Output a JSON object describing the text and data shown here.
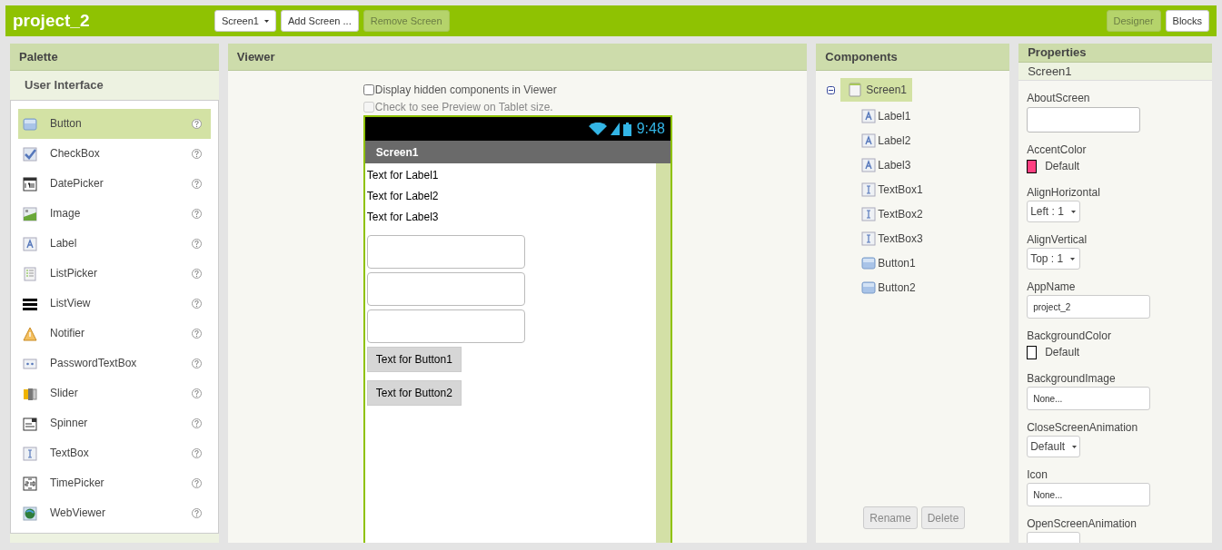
{
  "project_title": "project_2",
  "toolbar": {
    "screen_selector": "Screen1",
    "buttons": [
      {
        "label": "Add Screen ...",
        "disabled": false
      },
      {
        "label": "Remove Screen",
        "disabled": true
      }
    ]
  },
  "view_switch": [
    {
      "label": "Designer",
      "selected": true
    },
    {
      "label": "Blocks",
      "selected": false
    }
  ],
  "palette": {
    "title": "Palette",
    "category": "User Interface",
    "items": [
      {
        "label": "Button",
        "kind": "button",
        "selected": true
      },
      {
        "label": "CheckBox",
        "kind": "checkbox",
        "selected": false
      },
      {
        "label": "DatePicker",
        "kind": "datepicker",
        "selected": false
      },
      {
        "label": "Image",
        "kind": "image",
        "selected": false
      },
      {
        "label": "Label",
        "kind": "label",
        "selected": false
      },
      {
        "label": "ListPicker",
        "kind": "listpicker",
        "selected": false
      },
      {
        "label": "ListView",
        "kind": "listview",
        "selected": false
      },
      {
        "label": "Notifier",
        "kind": "notifier",
        "selected": false
      },
      {
        "label": "PasswordTextBox",
        "kind": "password",
        "selected": false
      },
      {
        "label": "Slider",
        "kind": "slider",
        "selected": false
      },
      {
        "label": "Spinner",
        "kind": "spinner",
        "selected": false
      },
      {
        "label": "TextBox",
        "kind": "textbox",
        "selected": false
      },
      {
        "label": "TimePicker",
        "kind": "timepicker",
        "selected": false
      },
      {
        "label": "WebViewer",
        "kind": "webviewer",
        "selected": false
      }
    ]
  },
  "viewer": {
    "title": "Viewer",
    "options": [
      {
        "label": "Display hidden components in Viewer",
        "checked": false,
        "disabled": false
      },
      {
        "label": "Check to see Preview on Tablet size.",
        "checked": false,
        "disabled": true
      }
    ],
    "phone": {
      "time": "9:48",
      "screen_title": "Screen1",
      "components": [
        {
          "kind": "label",
          "text": "Text for Label1"
        },
        {
          "kind": "label",
          "text": "Text for Label2"
        },
        {
          "kind": "label",
          "text": "Text for Label3"
        },
        {
          "kind": "textbox"
        },
        {
          "kind": "textbox"
        },
        {
          "kind": "textbox"
        },
        {
          "kind": "button",
          "text": "Text for Button1"
        },
        {
          "kind": "button",
          "text": "Text for Button2"
        }
      ]
    }
  },
  "components": {
    "title": "Components",
    "tree": {
      "label": "Screen1",
      "kind": "screen",
      "expanded": true,
      "selected": true,
      "children": [
        {
          "label": "Label1",
          "kind": "label"
        },
        {
          "label": "Label2",
          "kind": "label"
        },
        {
          "label": "Label3",
          "kind": "label"
        },
        {
          "label": "TextBox1",
          "kind": "textbox"
        },
        {
          "label": "TextBox2",
          "kind": "textbox"
        },
        {
          "label": "TextBox3",
          "kind": "textbox"
        },
        {
          "label": "Button1",
          "kind": "button"
        },
        {
          "label": "Button2",
          "kind": "button"
        }
      ]
    },
    "buttons": [
      {
        "label": "Rename",
        "disabled": true
      },
      {
        "label": "Delete",
        "disabled": true
      }
    ]
  },
  "properties": {
    "title": "Properties",
    "subject": "Screen1",
    "items": [
      {
        "name": "AboutScreen",
        "kind": "textarea"
      },
      {
        "name": "AccentColor",
        "kind": "color",
        "value": "Default",
        "color": "#ff4081"
      },
      {
        "name": "AlignHorizontal",
        "kind": "select",
        "value": "Left : 1"
      },
      {
        "name": "AlignVertical",
        "kind": "select",
        "value": "Top : 1"
      },
      {
        "name": "AppName",
        "kind": "text",
        "value": "project_2"
      },
      {
        "name": "BackgroundColor",
        "kind": "color",
        "value": "Default",
        "color": "#ffffff"
      },
      {
        "name": "BackgroundImage",
        "kind": "text",
        "value": "None..."
      },
      {
        "name": "CloseScreenAnimation",
        "kind": "select",
        "value": "Default"
      },
      {
        "name": "Icon",
        "kind": "text",
        "value": "None..."
      },
      {
        "name": "OpenScreenAnimation",
        "kind": "select"
      }
    ]
  }
}
